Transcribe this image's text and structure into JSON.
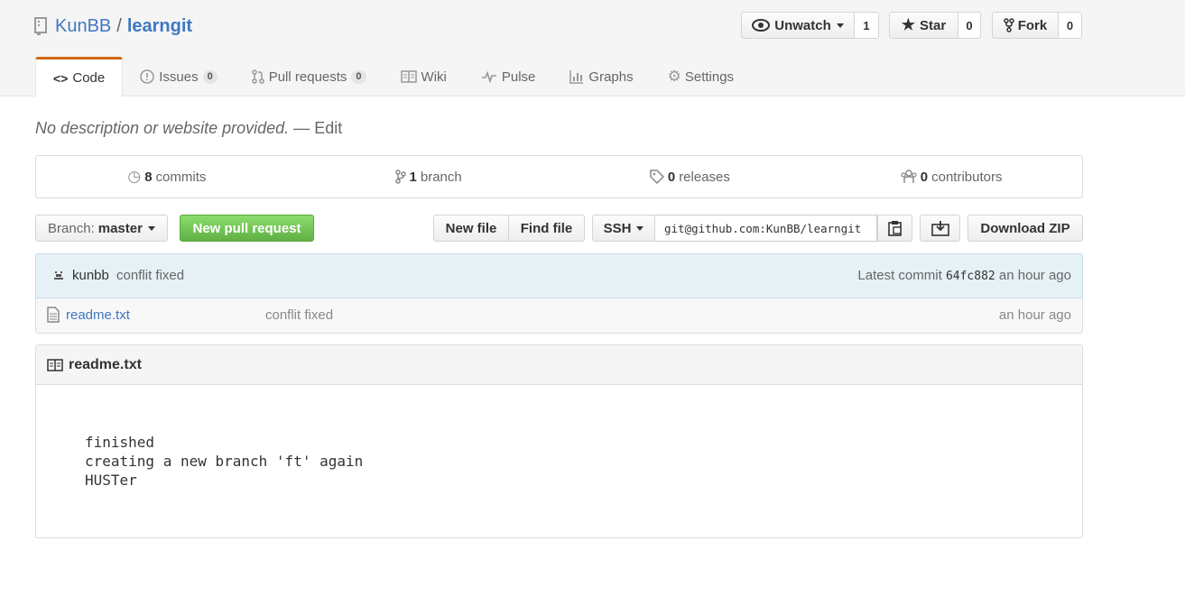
{
  "repo": {
    "owner": "KunBB",
    "separator": "/",
    "name": "learngit"
  },
  "actions": {
    "unwatch": {
      "label": "Unwatch",
      "count": "1"
    },
    "star": {
      "label": "Star",
      "count": "0"
    },
    "fork": {
      "label": "Fork",
      "count": "0"
    }
  },
  "tabs": [
    {
      "label": "Code",
      "active": true
    },
    {
      "label": "Issues",
      "count": "0"
    },
    {
      "label": "Pull requests",
      "count": "0"
    },
    {
      "label": "Wiki"
    },
    {
      "label": "Pulse"
    },
    {
      "label": "Graphs"
    },
    {
      "label": "Settings"
    }
  ],
  "description": {
    "text": "No description or website provided.",
    "dash": "—",
    "edit": "Edit"
  },
  "summary": {
    "commits": {
      "count": "8",
      "label": "commits"
    },
    "branches": {
      "count": "1",
      "label": "branch"
    },
    "releases": {
      "count": "0",
      "label": "releases"
    },
    "contributors": {
      "count": "0",
      "label": "contributors"
    }
  },
  "toolbar": {
    "branch_label": "Branch:",
    "branch_value": "master",
    "new_pr": "New pull request",
    "new_file": "New file",
    "find_file": "Find file",
    "protocol": "SSH",
    "clone_url": "git@github.com:KunBB/learngit",
    "download": "Download ZIP"
  },
  "commit": {
    "author": "kunbb",
    "message": "conflit fixed",
    "latest_label": "Latest commit",
    "sha": "64fc882",
    "age": "an hour ago"
  },
  "files": [
    {
      "name": "readme.txt",
      "message": "conflit fixed",
      "age": "an hour ago"
    }
  ],
  "readme": {
    "title": "readme.txt",
    "lines": [
      "finished",
      "creating a new branch 'ft' again",
      "HUSTer"
    ]
  },
  "colors": {
    "link": "#4078c0",
    "accent_tab": "#d26911",
    "primary_button": "#60b044",
    "commit_bar": "#e6f1f6"
  }
}
